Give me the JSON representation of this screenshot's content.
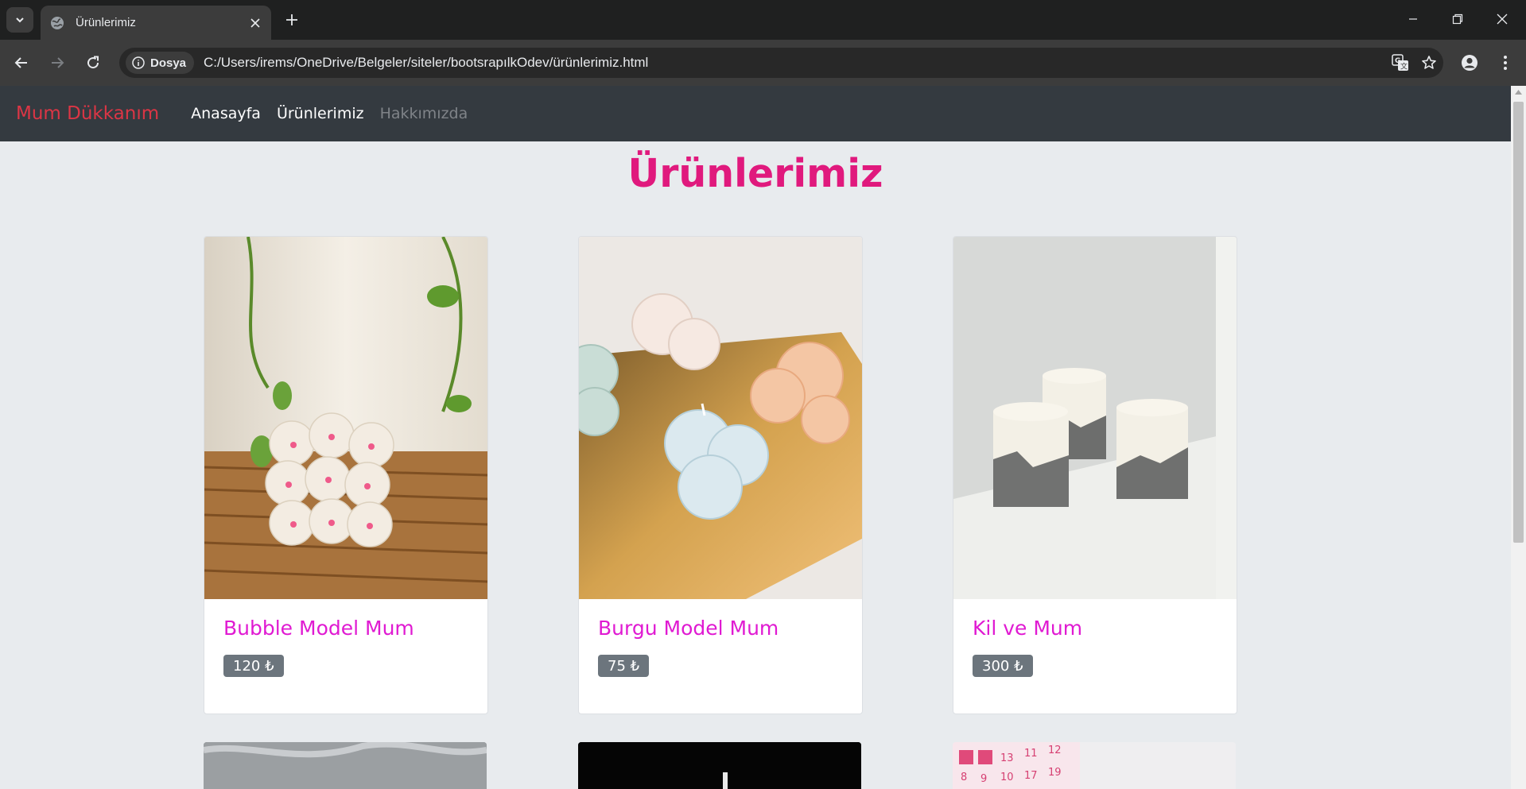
{
  "browser": {
    "tab_title": "Ürünlerimiz",
    "security_chip": "Dosya",
    "url": "C:/Users/irems/OneDrive/Belgeler/siteler/bootsrapılkOdev/ürünlerimiz.html"
  },
  "navbar": {
    "brand": "Mum Dükkanım",
    "links": [
      {
        "label": "Anasayfa",
        "active": true
      },
      {
        "label": "Ürünlerimiz",
        "active": true
      },
      {
        "label": "Hakkımızda",
        "active": false
      }
    ]
  },
  "page": {
    "heading": "Ürünlerimiz",
    "products": [
      {
        "name": "Bubble Model Mum",
        "price": "120 ₺"
      },
      {
        "name": "Burgu Model Mum",
        "price": "75 ₺"
      },
      {
        "name": "Kil ve Mum",
        "price": "300 ₺"
      }
    ]
  },
  "colors": {
    "brand": "#dc3545",
    "heading": "#e0197d",
    "product_title": "#e01ad2",
    "price_badge": "#6c757d",
    "navbar_bg": "#343a40"
  }
}
